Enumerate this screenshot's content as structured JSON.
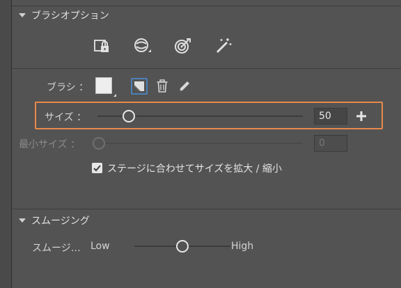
{
  "brush_options": {
    "section_title": "ブラシオプション",
    "tool_icons": [
      "lock-fill-icon",
      "brush-mode-icon",
      "target-icon",
      "magic-wand-icon"
    ],
    "brush_label": "ブラシ ：",
    "size": {
      "label": "サイズ ：",
      "value": "50"
    },
    "min_size": {
      "label": "最小サイズ ：",
      "value": "0"
    },
    "scale_checkbox": {
      "label": "ステージに合わせてサイズを拡大 / 縮小",
      "checked": true
    }
  },
  "smoothing": {
    "section_title": "スムージング",
    "label": "スムージ…",
    "low": "Low",
    "high": "High",
    "level": 0.5
  },
  "colors": {
    "background": "#535353",
    "highlight": "#e8894a"
  }
}
